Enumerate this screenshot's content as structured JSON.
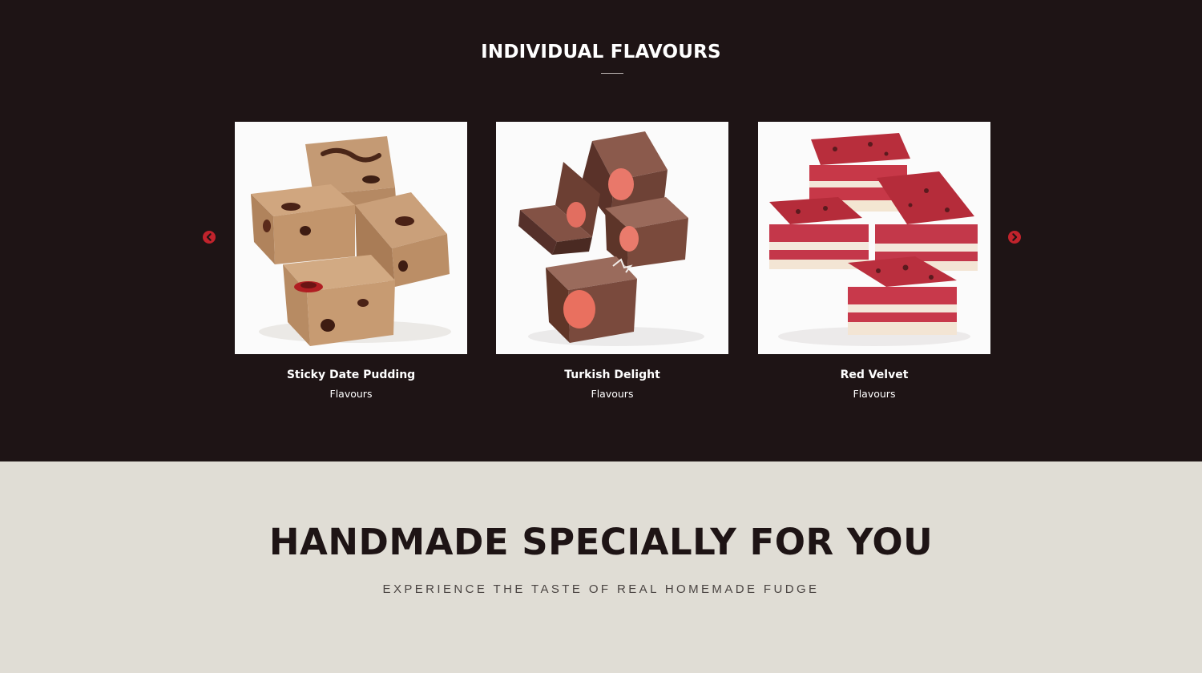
{
  "flavours_section": {
    "title": "INDIVIDUAL FLAVOURS",
    "background": "#1e1415",
    "accent": "#c1232c",
    "prev_icon": "chevron-left-circle-icon",
    "next_icon": "chevron-right-circle-icon",
    "cards": [
      {
        "name": "Sticky Date Pudding",
        "category": "Flavours",
        "image": "caramel-fudge-with-dates"
      },
      {
        "name": "Turkish Delight",
        "category": "Flavours",
        "image": "chocolate-fudge-with-pink-centre"
      },
      {
        "name": "Red Velvet",
        "category": "Flavours",
        "image": "red-and-white-layered-fudge"
      }
    ]
  },
  "promo_section": {
    "title": "HANDMADE SPECIALLY FOR YOU",
    "subtitle": "EXPERIENCE THE TASTE OF REAL HOMEMADE FUDGE",
    "background": "#e0ddd5"
  }
}
